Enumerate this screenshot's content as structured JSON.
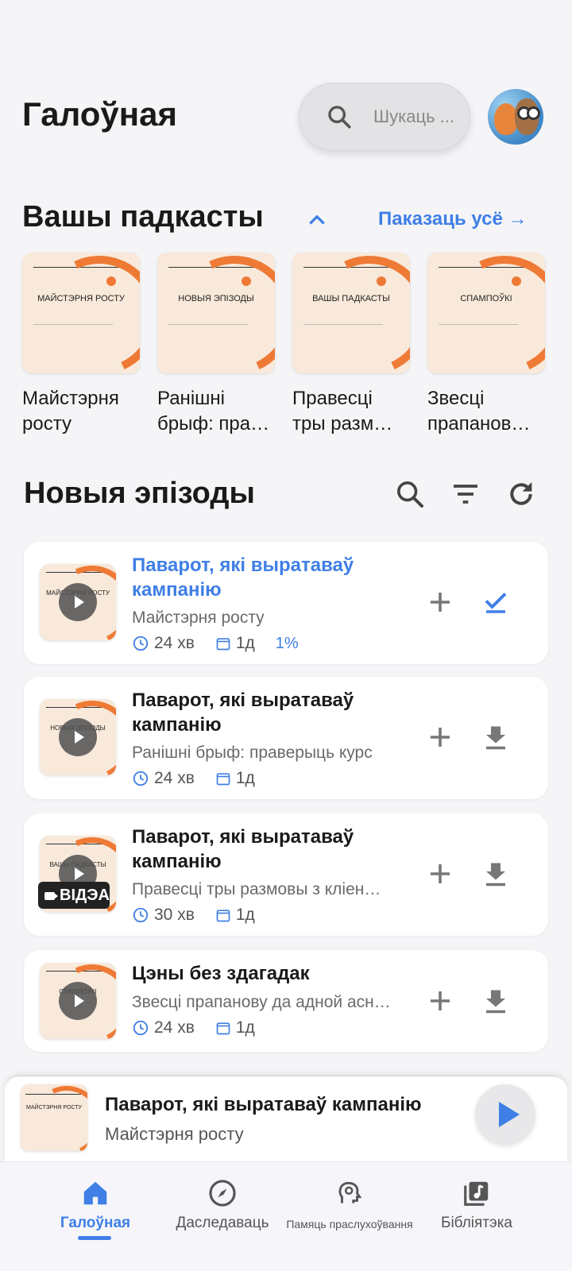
{
  "header": {
    "title": "Галоўная",
    "search_placeholder": "Шукаць ...",
    "avatar_icon": "avatar-fox-owl"
  },
  "podcasts_section": {
    "title": "Вашы падкасты",
    "show_all": "Паказаць усё →",
    "items": [
      {
        "cover_title": "МАЙСТЭРНЯ РОСТУ",
        "name_line1": "Майстэрня",
        "name_line2": "росту"
      },
      {
        "cover_title": "НОВЫЯ ЭПІЗОДЫ",
        "name_line1": "Ранішні",
        "name_line2": "брыф: пра…"
      },
      {
        "cover_title": "ВАШЫ ПАДКАСТЫ",
        "name_line1": "Правесці",
        "name_line2": "тры разм…"
      },
      {
        "cover_title": "СПАМПОЎКІ",
        "name_line1": "Звесці",
        "name_line2": "прапанов…"
      }
    ]
  },
  "episodes_section": {
    "title": "Новыя эпізоды",
    "episodes": [
      {
        "thumb_title": "МАЙСТЭРНЯ РОСТУ",
        "title_line1": "Паварот, які выратаваў",
        "title_line2": "кампанію",
        "podcast": "Майстэрня росту",
        "duration": "24 хв",
        "age": "1д",
        "progress": "1%",
        "status": "check"
      },
      {
        "thumb_title": "НОВЫЯ ЭПІЗОДЫ",
        "title_line1": "Паварот, які выратаваў",
        "title_line2": "кампанію",
        "podcast": "Ранішні брыф: праверыць курс",
        "duration": "24 хв",
        "age": "1д",
        "status": "download"
      },
      {
        "thumb_title": "ВАШЫ ПАДКАСТЫ",
        "title_line1": "Паварот, які выратаваў",
        "title_line2": "кампанію",
        "podcast": "Правесці тры размовы з кліен…",
        "duration": "30 хв",
        "age": "1д",
        "badge": "ВІДЭА",
        "status": "download"
      },
      {
        "thumb_title": "СПАМПОЎКІ",
        "title_line1": "Цэны без здагадак",
        "podcast": "Звесці прапанову да адной асн…",
        "duration": "24 хв",
        "age": "1д",
        "status": "download"
      }
    ]
  },
  "player": {
    "thumb_title": "МАЙСТЭРНЯ РОСТУ",
    "title": "Паварот, які выратаваў кампанію",
    "podcast": "Майстэрня росту"
  },
  "nav": {
    "home": "Галоўная",
    "explore": "Даследаваць",
    "memory": "Памяць праслухоўвання",
    "library": "Бібліятэка"
  },
  "colors": {
    "accent": "#3f7fe6",
    "cover_bg": "#f8e9da",
    "cover_arc": "#ef7a35"
  }
}
